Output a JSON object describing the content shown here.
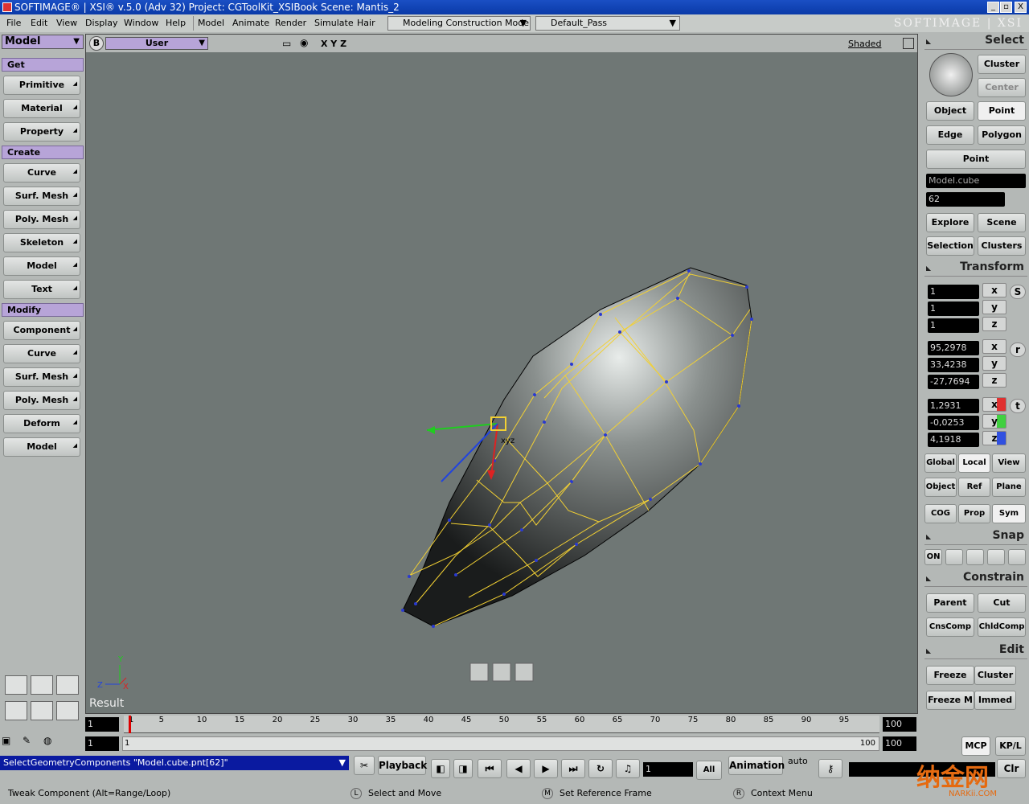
{
  "title": "SOFTIMAGE® | XSI® v.5.0 (Adv 32) Project: CGToolKit_XSIBook    Scene: Mantis_2",
  "window_btns": [
    "_",
    "▫",
    "X"
  ],
  "menus": [
    "File",
    "Edit",
    "View",
    "Display",
    "Window",
    "Help",
    "Model",
    "Animate",
    "Render",
    "Simulate",
    "Hair"
  ],
  "mode_dd": "Modeling Construction Mode",
  "pass_dd": "Default_Pass",
  "logo": "SOFTIMAGE | XSI",
  "left": {
    "module": "Model",
    "get": "Get",
    "get_items": [
      "Primitive",
      "Material",
      "Property"
    ],
    "create": "Create",
    "create_items": [
      "Curve",
      "Surf. Mesh",
      "Poly. Mesh",
      "Skeleton",
      "Model",
      "Text"
    ],
    "modify": "Modify",
    "modify_items": [
      "Component",
      "Curve",
      "Surf. Mesh",
      "Poly. Mesh",
      "Deform",
      "Model"
    ]
  },
  "viewport": {
    "b": "B",
    "view": "User",
    "axes": "X Y Z",
    "shading": "Shaded",
    "result": "Result",
    "handle_label": "xyz",
    "axis_x": "X",
    "axis_y": "Y",
    "axis_z": "Z"
  },
  "right": {
    "select": "Select",
    "cluster": "Cluster",
    "center": "Center",
    "object": "Object",
    "point": "Point",
    "edge": "Edge",
    "polygon": "Polygon",
    "filter": "Point",
    "name": "Model.cube",
    "count": "62",
    "explore": "Explore",
    "scene": "Scene",
    "selection": "Selection",
    "clusters": "Clusters",
    "transform": "Transform",
    "scale": [
      "1",
      "1",
      "1"
    ],
    "rot": [
      "95,2978",
      "33,4238",
      "-27,7694"
    ],
    "trans": [
      "1,2931",
      "-0,0253",
      "4,1918"
    ],
    "axes": [
      "x",
      "y",
      "z"
    ],
    "s": "S",
    "r": "r",
    "t": "t",
    "ref": [
      "Global",
      "Local",
      "View",
      "Object",
      "Ref",
      "Plane",
      "COG",
      "Prop",
      "Sym"
    ],
    "snap": "Snap",
    "on": "ON",
    "constrain": "Constrain",
    "parent": "Parent",
    "cut": "Cut",
    "cnscomp": "CnsComp",
    "chldcomp": "ChldComp",
    "edit": "Edit",
    "freeze": "Freeze",
    "cluster2": "Cluster",
    "freezem": "Freeze M",
    "immed": "Immed"
  },
  "timeline": {
    "start": "1",
    "end": "100",
    "ticks": [
      "1",
      "5",
      "10",
      "15",
      "20",
      "25",
      "30",
      "35",
      "40",
      "45",
      "50",
      "55",
      "60",
      "65",
      "70",
      "75",
      "80",
      "85",
      "90",
      "95"
    ],
    "start2": "1",
    "endlabel": "100",
    "end2": "100"
  },
  "bottom": {
    "cmd": "SelectGeometryComponents \"Model.cube.pnt[62]\"",
    "playback": "Playback",
    "frame": "1",
    "all": "All",
    "animation": "Animation",
    "auto": "auto",
    "mcp": "MCP",
    "kpl": "KP/L",
    "clr": "Clr"
  },
  "status": {
    "left": "Tweak Component  (Alt=Range/Loop)",
    "l": "L",
    "l_text": "Select and Move",
    "m": "M",
    "m_text": "Set Reference Frame",
    "r": "R",
    "r_text": "Context Menu"
  },
  "watermark": "纳金网",
  "watermark_sub": "NARKii.COM"
}
